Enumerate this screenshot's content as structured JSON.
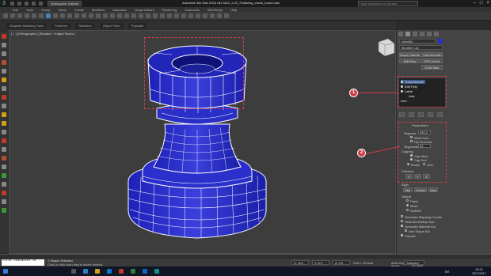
{
  "titlebar": {
    "workspace": "Workspace: Default",
    "app_title": "Autodesk 3ds Max  2016 x64     MAX_LCK_Finalizing_chess_board.max",
    "search_placeholder": "Type a keyword or phrase",
    "minimize": "–",
    "maximize": "□",
    "close": "×"
  },
  "menubar": [
    "Edit",
    "Tools",
    "Group",
    "Views",
    "Create",
    "Modifiers",
    "Animation",
    "Graph Editors",
    "Rendering",
    "Customize",
    "MAXScript",
    "Help"
  ],
  "ribbon": {
    "tabs": [
      "Graphite Modeling Tools",
      "Freeform",
      "Selection",
      "Object Paint",
      "Populate"
    ]
  },
  "viewport": {
    "label": "[ + ] [Orthographic ] [Shaded + Edged Faces ]"
  },
  "command_panel": {
    "object_name": "Line004",
    "modifier_list": "Modifier List",
    "buttons": {
      "quad_chamfer": "Quad Chamfer",
      "turbosmooth": "TurboSmooth",
      "edit_poly": "Edit Poly",
      "ffd": "FFD 2x2x2",
      "uvw_map": "UVW Map"
    },
    "stack": [
      "TurboSmooth",
      "Edit Poly",
      "Lathe",
      "Axis",
      "Line"
    ],
    "parameters": {
      "title": "Parameters",
      "degrees_label": "Degrees:",
      "degrees_value": "360.0",
      "weld_core": "Weld Core",
      "flip_normals": "Flip Normals",
      "segments_label": "Segments:",
      "segments_value": "32",
      "capping": "Capping",
      "cap_start": "Cap Start",
      "cap_end": "Cap End",
      "morph": "Morph",
      "grid": "Grid",
      "direction": "Direction",
      "x": "X",
      "y": "Y",
      "z": "Z",
      "align": "Align",
      "min": "Min",
      "center": "Center",
      "max": "Max",
      "output": "Output",
      "patch": "Patch",
      "mesh": "Mesh",
      "nurbs": "NURBS",
      "gen_mapping": "Generate Mapping Coords.",
      "real_world": "Real-World Map Size",
      "gen_mat_ids": "Generate Material IDs",
      "use_shape_ids": "Use Shape IDs",
      "smooth": "Smooth"
    }
  },
  "callouts": {
    "one": "1",
    "two": "2"
  },
  "status": {
    "maxscript": "first character of",
    "selected": "1 Shape Selected",
    "prompt": "Click or click-and-drag to select objects",
    "x": "X: -8.0",
    "y": "Y: 0.0",
    "z": "Z: 0.0",
    "grid": "Grid = 10.0cm",
    "autokey": "Auto Key",
    "selected_dropdown": "Selected",
    "set_key": "Set Key",
    "key_filters": "Key Filters..."
  },
  "taskbar": {
    "lang": "BR",
    "time": "18:21",
    "date": "28/7/2017"
  },
  "colors": {
    "object_blue": "#2233cc",
    "callout_red": "#d23c4a"
  }
}
